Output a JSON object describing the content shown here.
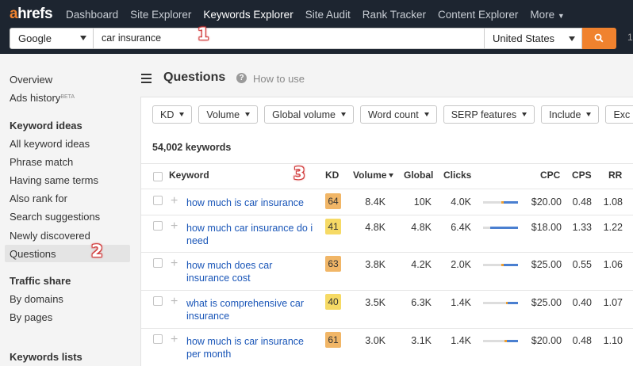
{
  "nav": {
    "logo_a": "a",
    "logo_rest": "hrefs",
    "items": [
      "Dashboard",
      "Site Explorer",
      "Keywords Explorer",
      "Site Audit",
      "Rank Tracker",
      "Content Explorer",
      "More"
    ],
    "active": "Keywords Explorer"
  },
  "search": {
    "engine": "Google",
    "query": "car insurance",
    "country": "United States",
    "extra": "1"
  },
  "sidebar": {
    "top_items": [
      "Overview",
      "Ads history"
    ],
    "beta_label": "BETA",
    "groups": [
      {
        "heading": "Keyword ideas",
        "items": [
          "All keyword ideas",
          "Phrase match",
          "Having same terms",
          "Also rank for",
          "Search suggestions",
          "Newly discovered",
          "Questions"
        ]
      },
      {
        "heading": "Traffic share",
        "items": [
          "By domains",
          "By pages"
        ]
      },
      {
        "heading": "Keywords lists",
        "items": []
      }
    ],
    "selected": "Questions"
  },
  "main": {
    "title": "Questions",
    "help_icon": "?",
    "help_text": "How to use",
    "filters": [
      "KD",
      "Volume",
      "Global volume",
      "Word count",
      "SERP features",
      "Include",
      "Exc"
    ],
    "count_text": "54,002 keywords",
    "columns": {
      "keyword": "Keyword",
      "kd": "KD",
      "volume": "Volume",
      "global": "Global",
      "clicks": "Clicks",
      "cpc": "CPC",
      "cps": "CPS",
      "rr": "RR"
    },
    "rows": [
      {
        "keyword": "how much is car insurance",
        "kd": "64",
        "volume": "8.4K",
        "global": "10K",
        "clicks": "4.0K",
        "cpc": "$20.00",
        "cps": "0.48",
        "rr": "1.08",
        "kd_color": "#f1b667"
      },
      {
        "keyword": "how much car insurance do i need",
        "kd": "41",
        "volume": "4.8K",
        "global": "4.8K",
        "clicks": "6.4K",
        "cpc": "$18.00",
        "cps": "1.33",
        "rr": "1.22",
        "kd_color": "#f6da65"
      },
      {
        "keyword": "how much does car insurance cost",
        "kd": "63",
        "volume": "3.8K",
        "global": "4.2K",
        "clicks": "2.0K",
        "cpc": "$25.00",
        "cps": "0.55",
        "rr": "1.06",
        "kd_color": "#f1b667"
      },
      {
        "keyword": "what is comprehensive car insurance",
        "kd": "40",
        "volume": "3.5K",
        "global": "6.3K",
        "clicks": "1.4K",
        "cpc": "$25.00",
        "cps": "0.40",
        "rr": "1.07",
        "kd_color": "#f6da65"
      },
      {
        "keyword": "how much is car insurance per month",
        "kd": "61",
        "volume": "3.0K",
        "global": "3.1K",
        "clicks": "1.4K",
        "cpc": "$20.00",
        "cps": "0.48",
        "rr": "1.10",
        "kd_color": "#f1b667"
      }
    ]
  },
  "annotations": [
    "1",
    "2",
    "3"
  ],
  "colors": {
    "nav_bg": "#1d2530",
    "accent": "#f0822e",
    "link": "#1a56b8",
    "bar_blue": "#4a7fd0",
    "bar_orange": "#f0a030"
  }
}
